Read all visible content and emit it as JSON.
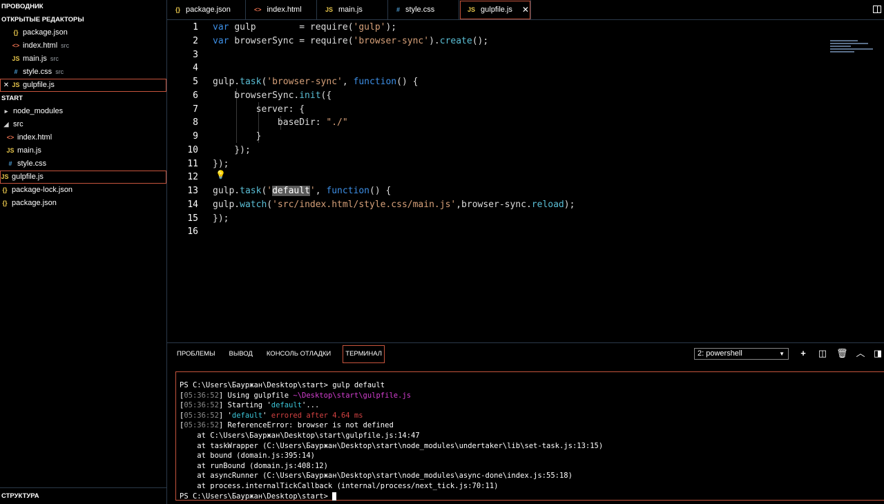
{
  "sidebar": {
    "title": "ПРОВОДНИК",
    "open_editors_title": "ОТКРЫТЫЕ РЕДАКТОРЫ",
    "open_editors": [
      {
        "icon": "{}",
        "name": "package.json",
        "sub": ""
      },
      {
        "icon": "<>",
        "name": "index.html",
        "sub": "src"
      },
      {
        "icon": "JS",
        "name": "main.js",
        "sub": "src"
      },
      {
        "icon": "#",
        "name": "style.css",
        "sub": "src"
      },
      {
        "icon": "JS",
        "name": "gulpfile.js",
        "sub": "",
        "close": "✕"
      }
    ],
    "folder_title": "START",
    "tree": [
      {
        "icon": "▸",
        "name": "node_modules"
      },
      {
        "icon": "◢",
        "name": "src"
      },
      {
        "icon": "<>",
        "name": "index.html"
      },
      {
        "icon": "JS",
        "name": "main.js"
      },
      {
        "icon": "#",
        "name": "style.css"
      },
      {
        "icon": "JS",
        "name": "gulpfile.js"
      },
      {
        "icon": "{}",
        "name": "package-lock.json"
      },
      {
        "icon": "{}",
        "name": "package.json"
      }
    ],
    "outline_title": "СТРУКТУРА"
  },
  "tabs": [
    {
      "icon": "{}",
      "label": "package.json"
    },
    {
      "icon": "<>",
      "label": "index.html"
    },
    {
      "icon": "JS",
      "label": "main.js"
    },
    {
      "icon": "#",
      "label": "style.css"
    },
    {
      "icon": "JS",
      "label": "gulpfile.js",
      "close": "✕"
    }
  ],
  "editor": {
    "line_numbers": [
      "1",
      "2",
      "3",
      "4",
      "5",
      "6",
      "7",
      "8",
      "9",
      "10",
      "11",
      "12",
      "13",
      "14",
      "15",
      "16"
    ],
    "lines": [
      [
        [
          "kw",
          "var "
        ],
        [
          "pl",
          "gulp        = "
        ],
        [
          "pl",
          "require"
        ],
        [
          "pl",
          "("
        ],
        [
          "str",
          "'gulp'"
        ],
        [
          "pl",
          ");"
        ]
      ],
      [
        [
          "kw",
          "var "
        ],
        [
          "pl",
          "browserSync = "
        ],
        [
          "pl",
          "require"
        ],
        [
          "pl",
          "("
        ],
        [
          "str",
          "'browser-sync'"
        ],
        [
          "pl",
          ")."
        ],
        [
          "fn",
          "create"
        ],
        [
          "pl",
          "();"
        ]
      ],
      [],
      [],
      [
        [
          "pl",
          "gulp."
        ],
        [
          "fn",
          "task"
        ],
        [
          "pl",
          "("
        ],
        [
          "str",
          "'browser-sync'"
        ],
        [
          "pl",
          ", "
        ],
        [
          "kw",
          "function"
        ],
        [
          "pl",
          "() {"
        ]
      ],
      [
        [
          "pl",
          "    browserSync."
        ],
        [
          "fn",
          "init"
        ],
        [
          "pl",
          "({"
        ]
      ],
      [
        [
          "pl",
          "        server: {"
        ]
      ],
      [
        [
          "pl",
          "            baseDir: "
        ],
        [
          "str",
          "\"./\""
        ]
      ],
      [
        [
          "pl",
          "        }"
        ]
      ],
      [
        [
          "pl",
          "    });"
        ]
      ],
      [
        [
          "pl",
          "});"
        ]
      ],
      [],
      [
        [
          "pl",
          "gulp."
        ],
        [
          "fn",
          "task"
        ],
        [
          "pl",
          "("
        ],
        [
          "str",
          "'"
        ],
        [
          "hl",
          "default"
        ],
        [
          "str",
          "'"
        ],
        [
          "pl",
          ", "
        ],
        [
          "kw",
          "function"
        ],
        [
          "pl",
          "() {"
        ]
      ],
      [
        [
          "pl",
          "gulp."
        ],
        [
          "fn",
          "watch"
        ],
        [
          "pl",
          "("
        ],
        [
          "str",
          "'src/index.html/style.css/main.js'"
        ],
        [
          "pl",
          ",browser-sync."
        ],
        [
          "fn",
          "reload"
        ],
        [
          "pl",
          ");"
        ]
      ],
      [
        [
          "pl",
          "});"
        ]
      ],
      []
    ],
    "bulb_icon": "💡"
  },
  "panel": {
    "tabs": [
      "ПРОБЛЕМЫ",
      "ВЫВОД",
      "КОНСОЛЬ ОТЛАДКИ",
      "ТЕРМИНАЛ"
    ],
    "shell_select": "2: powershell",
    "terminal": [
      [
        [
          "w",
          "PS C:\\Users\\Бауржан\\Desktop\\start> gulp default"
        ]
      ],
      [
        [
          "w",
          "["
        ],
        [
          "g",
          "05:36:52"
        ],
        [
          "w",
          "] Using gulpfile "
        ],
        [
          "m",
          "~\\Desktop\\start\\gulpfile.js"
        ]
      ],
      [
        [
          "w",
          "["
        ],
        [
          "g",
          "05:36:52"
        ],
        [
          "w",
          "] Starting '"
        ],
        [
          "c",
          "default"
        ],
        [
          "w",
          "'..."
        ]
      ],
      [
        [
          "w",
          "["
        ],
        [
          "g",
          "05:36:52"
        ],
        [
          "w",
          "] '"
        ],
        [
          "c",
          "default"
        ],
        [
          "w",
          "' "
        ],
        [
          "r",
          "errored after 4.64 ms"
        ]
      ],
      [
        [
          "w",
          "["
        ],
        [
          "g",
          "05:36:52"
        ],
        [
          "w",
          "] ReferenceError: browser is not defined"
        ]
      ],
      [
        [
          "w",
          "    at C:\\Users\\Бауржан\\Desktop\\start\\gulpfile.js:14:47"
        ]
      ],
      [
        [
          "w",
          "    at taskWrapper (C:\\Users\\Бауржан\\Desktop\\start\\node_modules\\undertaker\\lib\\set-task.js:13:15)"
        ]
      ],
      [
        [
          "w",
          "    at bound (domain.js:395:14)"
        ]
      ],
      [
        [
          "w",
          "    at runBound (domain.js:408:12)"
        ]
      ],
      [
        [
          "w",
          "    at asyncRunner (C:\\Users\\Бауржан\\Desktop\\start\\node_modules\\async-done\\index.js:55:18)"
        ]
      ],
      [
        [
          "w",
          "    at process.internalTickCallback (internal/process/next_tick.js:70:11)"
        ]
      ],
      [
        [
          "w",
          "PS C:\\Users\\Бауржан\\Desktop\\start> "
        ]
      ]
    ]
  }
}
